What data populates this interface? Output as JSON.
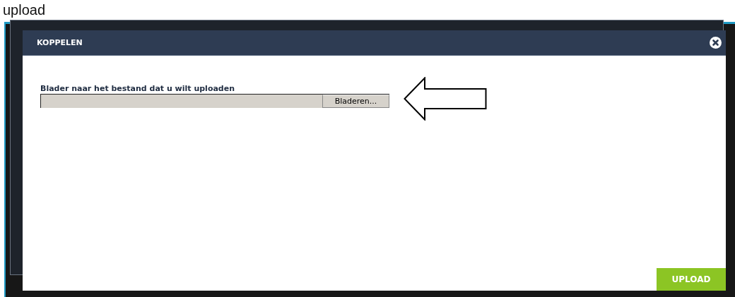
{
  "caption": "upload",
  "dialog": {
    "title": "KOPPELEN",
    "field_label": "Blader naar het bestand dat u wilt uploaden",
    "browse_button": "Bladeren...",
    "submit_button": "UPLOAD"
  }
}
